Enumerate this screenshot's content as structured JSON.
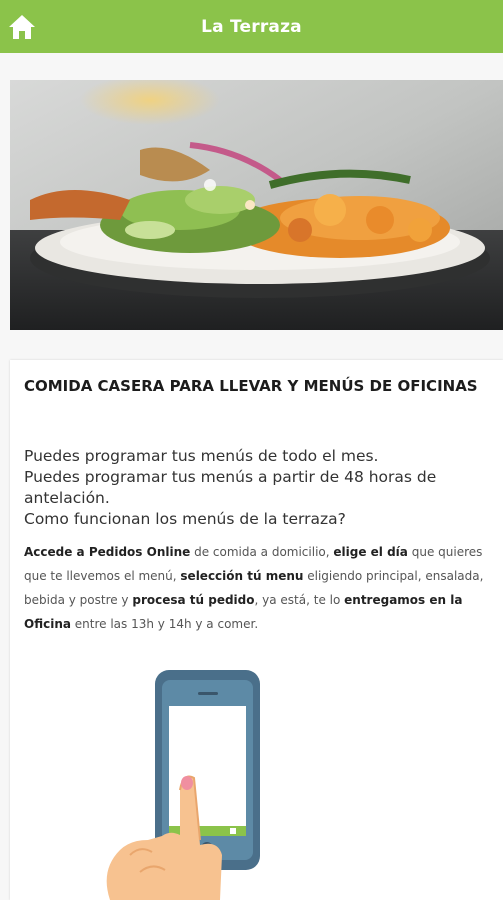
{
  "header": {
    "title": "La Terraza",
    "home_icon": "home-icon",
    "color": "#8bc34a"
  },
  "hero_image": {
    "description_icon": "food-plate-photo"
  },
  "article": {
    "title": "COMIDA CASERA PARA LLEVAR Y MENÚS DE OFICINAS",
    "lines": [
      "Puedes programar tus menús de todo el mes.",
      "Puedes programar tus menús a partir de 48 horas de antelación.",
      "Como funcionan los menús de la terraza?"
    ],
    "description": {
      "part1_bold": "Accede a Pedidos Online",
      "part2": " de comida a domicilio, ",
      "part3_bold": "elige el día",
      "part4": " que quieres que te llevemos el menú, ",
      "part5_bold": "selección tú menu",
      "part6": " eligiendo principal, ensalada, bebida y postre y ",
      "part7_bold": "procesa tú pedido",
      "part8": ", ya está, te lo ",
      "part9_bold": "entregamos en la Oficina",
      "part10": " entre las 13h y 14h y a comer."
    },
    "illustration_icon": "phone-tap-icon"
  }
}
